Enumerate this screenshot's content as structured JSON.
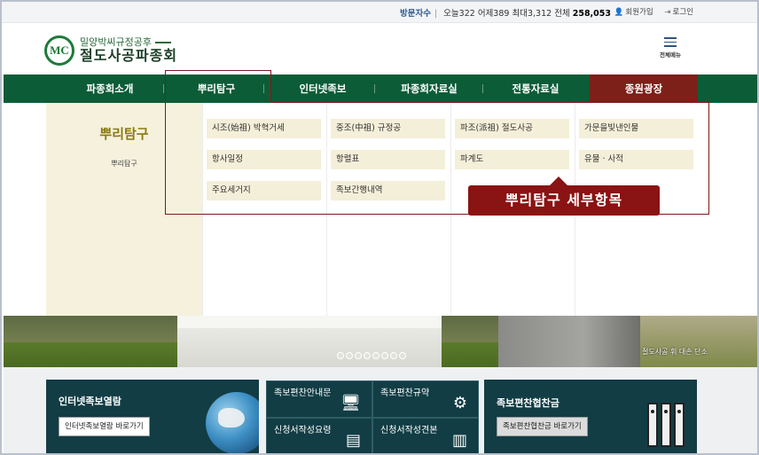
{
  "topbar": {
    "visitor_label": "방문자수",
    "today": "오늘322",
    "yesterday": "어제389",
    "max": "최대3,312",
    "total_label": "전체",
    "total_value": "258,053",
    "signup": "회원가입",
    "login": "로그인"
  },
  "header": {
    "logo_mark": "MC",
    "logo_sub": "밀양박씨규정공후",
    "logo_main": "절도사공파종회",
    "allmenu_label": "전체메뉴"
  },
  "gnb": [
    {
      "label": "파종회소개"
    },
    {
      "label": "뿌리탐구"
    },
    {
      "label": "인터넷족보"
    },
    {
      "label": "파종회자료실"
    },
    {
      "label": "전통자료실"
    },
    {
      "label": "종원광장"
    }
  ],
  "dropdown": {
    "title": "뿌리탐구",
    "subtitle": "뿌리탐구",
    "items": [
      "시조(始祖) 박혁거세",
      "중조(中祖) 규정공",
      "파조(派祖) 절도사공",
      "가문을빛낸인물",
      "항사일정",
      "항렬표",
      "파계도",
      "유물 · 사적",
      "주요세거지",
      "족보간행내역"
    ]
  },
  "callout": "뿌리탐구 세부항목",
  "banner": {
    "caption": "절도사공 휘 대손 단소",
    "slides": 8
  },
  "bottom": {
    "card1_title": "인터넷족보열람",
    "card1_button": "인터넷족보열람 바로가기",
    "quad": [
      "족보편찬안내문",
      "족보편찬규약",
      "신청서작성요령",
      "신청서작성견본"
    ],
    "card2_title": "족보편찬협찬금",
    "card2_button": "족보편찬협찬금 바로가기"
  },
  "colors": {
    "gnb": "#0c5c38",
    "gnb_active": "#7d2019",
    "dropdown_item_bg": "#f4efd9",
    "card_bg": "#123d45",
    "callout": "#8a1313"
  }
}
